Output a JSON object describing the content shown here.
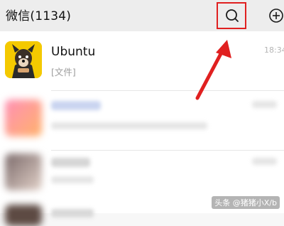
{
  "header": {
    "title": "微信(1134)",
    "search_icon": "search-icon",
    "add_icon": "plus-circle-icon"
  },
  "chats": [
    {
      "name": "Ubuntu",
      "message": "[文件]",
      "time": "18:34",
      "avatar": "dog-avatar"
    },
    {
      "name": "",
      "message": "",
      "time": "",
      "avatar": "blurred-avatar"
    },
    {
      "name": "",
      "message": "",
      "time": "",
      "avatar": "blurred-avatar"
    }
  ],
  "annotation": {
    "highlight_color": "#e02020"
  },
  "watermark": {
    "text": "头条 @猪猪小X/b"
  },
  "colors": {
    "header_bg": "#ededed",
    "accent_red": "#e02020"
  }
}
